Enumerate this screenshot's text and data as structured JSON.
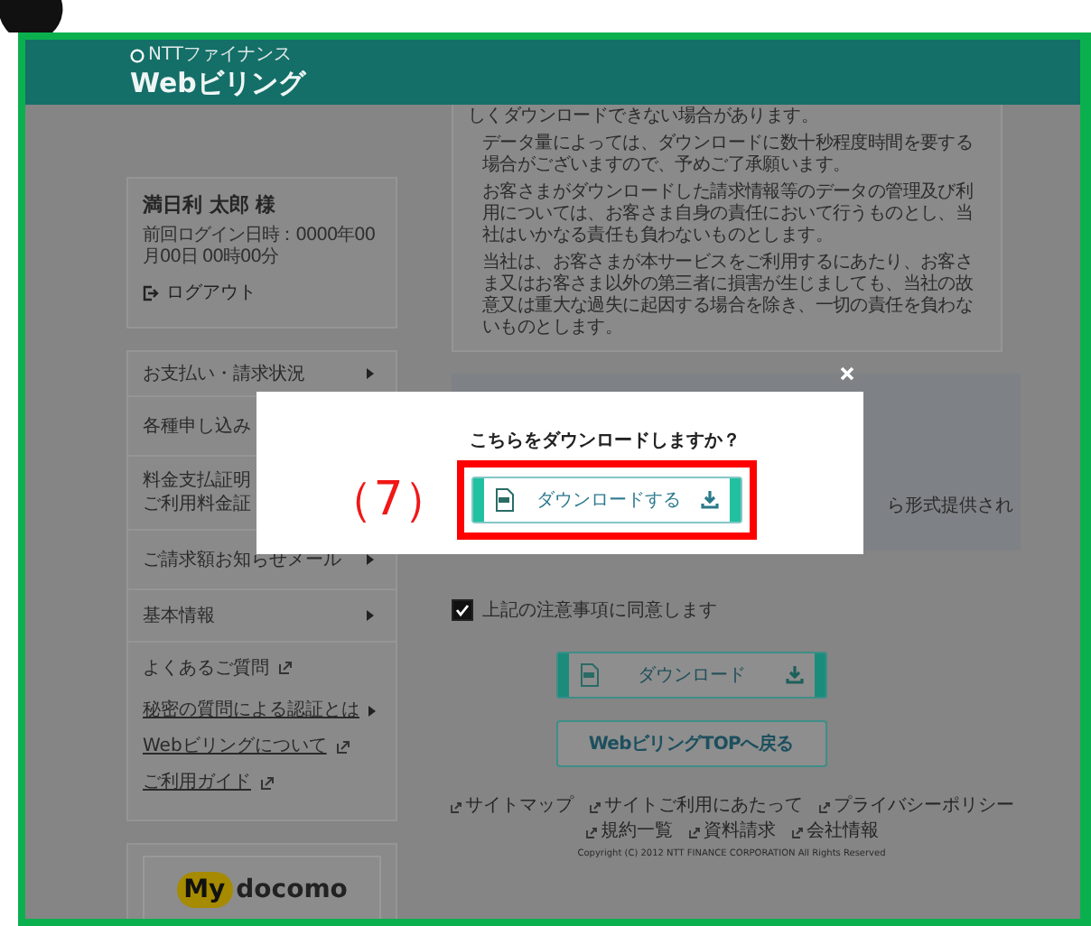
{
  "header": {
    "brand": "NTTファイナンス",
    "title": "Webビリング"
  },
  "user": {
    "name": "満日利 太郎 様",
    "last_login": "前回ログイン日時：0000年00月00日 00時00分",
    "logout": "ログアウト"
  },
  "menu": [
    {
      "lines": [
        "お支払い・請求状況"
      ],
      "kind": "arrow"
    },
    {
      "lines": [
        "各種申し込み"
      ],
      "kind": "none"
    },
    {
      "lines": [
        "料金支払証明",
        "ご利用料金証"
      ],
      "kind": "none"
    },
    {
      "lines": [
        "ご請求額お知らせメール"
      ],
      "kind": "arrow"
    },
    {
      "lines": [
        "基本情報"
      ],
      "kind": "arrow"
    },
    {
      "lines": [
        "よくあるご質問"
      ],
      "kind": "external"
    }
  ],
  "links": [
    {
      "label": "秘密の質問による認証とは",
      "kind": "arrow"
    },
    {
      "label": "Webビリングについて",
      "kind": "external"
    },
    {
      "label": "ご利用ガイド",
      "kind": "external"
    }
  ],
  "mydocomo": {
    "my": "My",
    "brand": "docomo"
  },
  "notice": {
    "lead": "しくダウンロードできない場合があります。",
    "bullets": [
      "データ量によっては、ダウンロードに数十秒程度時間を要する場合がございますので、予めご了承願います。",
      "お客さまがダウンロードした請求情報等のデータの管理及び利用については、お客さま自身の責任において行うものとし、当社はいかなる責任も負わないものとします。",
      "当社は、お客さまが本サービスをご利用するにあたり、お客さま又はお客さま以外の第三者に損害が生じましても、当社の故意又は重大な過失に起因する場合を除き、一切の責任を負わないものとします。"
    ]
  },
  "info_box": {
    "text": "ら形式提供され"
  },
  "agree": {
    "label": "上記の注意事項に同意します",
    "checked": true
  },
  "buttons": [
    {
      "label": "ダウンロード",
      "kind": "download"
    },
    {
      "label": "WebビリングTOPへ戻る",
      "kind": "plain"
    }
  ],
  "footer": {
    "links": [
      "サイトマップ",
      "サイトご利用にあたって",
      "プライバシーポリシー",
      "規約一覧",
      "資料請求",
      "会社情報"
    ],
    "copyright": "Copyright (C) 2012 NTT FINANCE CORPORATION All Rights Reserved"
  },
  "dialog": {
    "question": "こちらをダウンロードしますか？",
    "button": "ダウンロードする",
    "annotation": "（7）"
  }
}
